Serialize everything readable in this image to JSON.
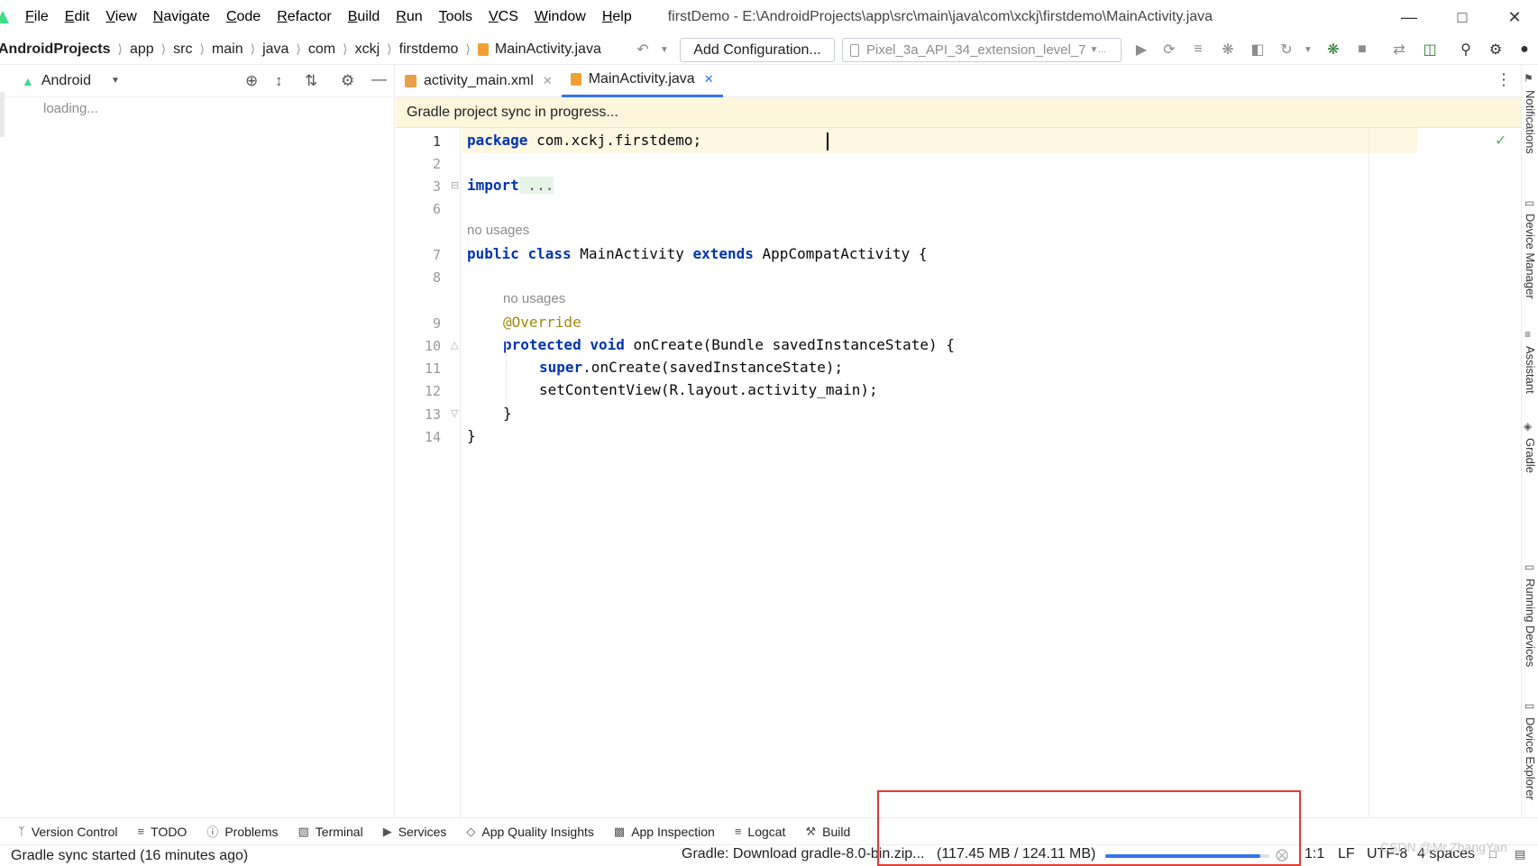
{
  "menubar": {
    "items": [
      "File",
      "Edit",
      "View",
      "Navigate",
      "Code",
      "Refactor",
      "Build",
      "Run",
      "Tools",
      "VCS",
      "Window",
      "Help"
    ],
    "window_title": "firstDemo - E:\\AndroidProjects\\app\\src\\main\\java\\com\\xckj\\firstdemo\\MainActivity.java"
  },
  "breadcrumb": [
    "AndroidProjects",
    "app",
    "src",
    "main",
    "java",
    "com",
    "xckj",
    "firstdemo",
    "MainActivity.java"
  ],
  "toolbar": {
    "add_configuration": "Add Configuration...",
    "device": "Pixel_3a_API_34_extension_level_7"
  },
  "project_panel": {
    "view_mode": "Android",
    "loading_text": "loading..."
  },
  "editor": {
    "tabs": [
      {
        "label": "activity_main.xml",
        "active": false
      },
      {
        "label": "MainActivity.java",
        "active": true
      }
    ],
    "banner": "Gradle project sync in progress...",
    "line_numbers": [
      "1",
      "2",
      "3",
      "6",
      "7",
      "8",
      "9",
      "10",
      "11",
      "12",
      "13",
      "14"
    ],
    "hint_no_usages": "no usages",
    "code": {
      "l1_kw": "package",
      "l1_rest": " com.xckj.firstdemo;",
      "l3_kw": "import",
      "l3_rest": " ...",
      "l7_kw1": "public",
      "l7_kw2": "class",
      "l7_mid": " MainActivity ",
      "l7_kw3": "extends",
      "l7_rest": " AppCompatActivity {",
      "l9": "@Override",
      "l10_kw1": "protected",
      "l10_kw2": "void",
      "l10_rest": " onCreate(Bundle savedInstanceState) {",
      "l11_kw": "super",
      "l11_rest": ".onCreate(savedInstanceState);",
      "l12": "setContentView(R.layout.activity_main);",
      "l13": "}",
      "l14": "}"
    }
  },
  "right_sidebar": [
    "Notifications",
    "Device Manager",
    "Assistant",
    "Gradle",
    "Running Devices",
    "Device Explorer"
  ],
  "tool_windows": [
    "Version Control",
    "TODO",
    "Problems",
    "Terminal",
    "Services",
    "App Quality Insights",
    "App Inspection",
    "Logcat",
    "Build"
  ],
  "status": {
    "left": "Gradle sync started (16 minutes ago)",
    "download": "Gradle: Download gradle-8.0-bin.zip...",
    "download_size": "(117.45 MB / 124.11 MB)",
    "progress": 0.946,
    "position": "1:1",
    "line_sep": "LF",
    "encoding": "UTF-8",
    "indent": "4 spaces",
    "watermark": "CSDN @Mr.ZhangYan"
  },
  "colors": {
    "accent": "#3574f0",
    "keyword": "#0033b3",
    "highlight_box": "#e53935",
    "android": "#3ddc84"
  }
}
